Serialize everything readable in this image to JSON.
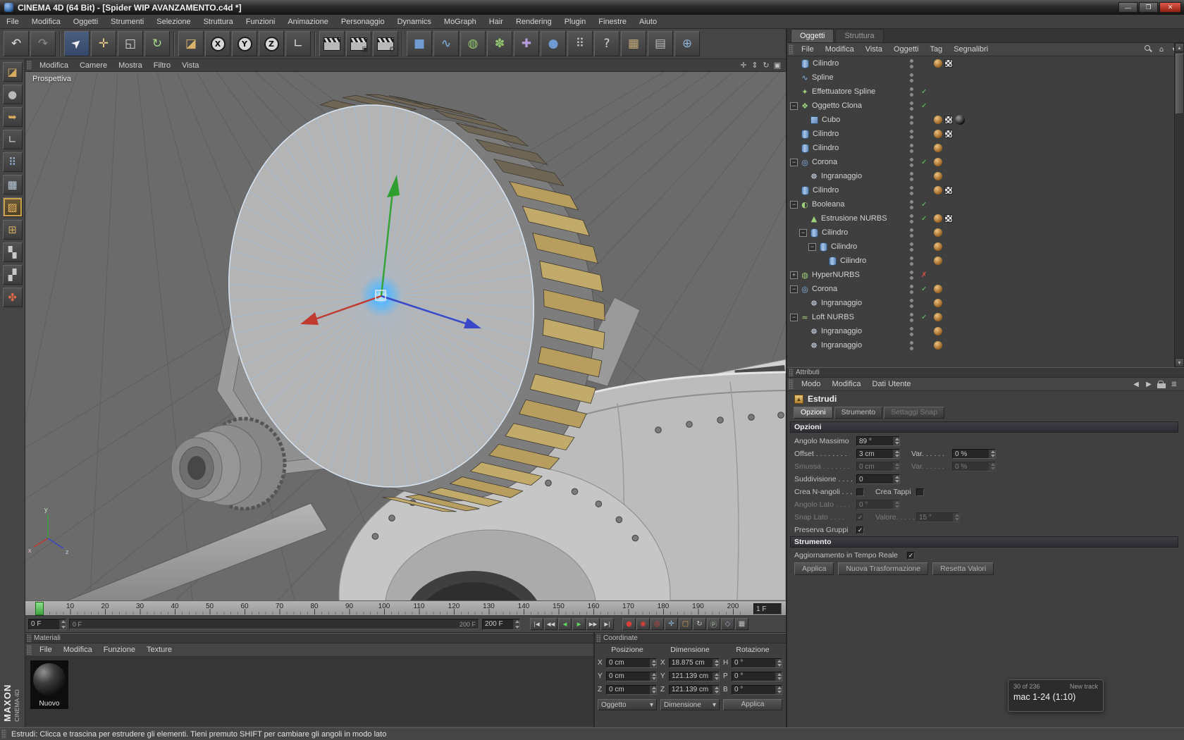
{
  "window": {
    "title": "CINEMA 4D (64 Bit) - [Spider WIP AVANZAMENTO.c4d *]",
    "controls": {
      "minimize": "—",
      "restore": "❐",
      "close": "✕"
    }
  },
  "menubar": [
    "File",
    "Modifica",
    "Oggetti",
    "Strumenti",
    "Selezione",
    "Struttura",
    "Funzioni",
    "Animazione",
    "Personaggio",
    "Dynamics",
    "MoGraph",
    "Hair",
    "Rendering",
    "Plugin",
    "Finestre",
    "Aiuto"
  ],
  "toolbar": [
    {
      "name": "undo-button",
      "glyph": "↶",
      "fg": "#e0e0e0"
    },
    {
      "name": "redo-button",
      "glyph": "↷",
      "fg": "#8a8a8a"
    },
    {
      "sep": true
    },
    {
      "name": "live-selection-tool",
      "glyph": "➤",
      "fg": "#f0f0f0",
      "rot": -40,
      "bg": true
    },
    {
      "name": "move-tool",
      "glyph": "✛",
      "fg": "#e6c98a"
    },
    {
      "name": "scale-tool",
      "glyph": "◱",
      "fg": "#dcdcdc"
    },
    {
      "name": "rotate-tool",
      "glyph": "↻",
      "fg": "#a6d88a"
    },
    {
      "sep": true
    },
    {
      "name": "last-used-tool",
      "glyph": "◪",
      "fg": "#d8b26a"
    },
    {
      "name": "lock-x-axis-button",
      "axis": "X"
    },
    {
      "name": "lock-y-axis-button",
      "axis": "Y"
    },
    {
      "name": "lock-z-axis-button",
      "axis": "Z"
    },
    {
      "name": "coordinate-system-toggle",
      "glyph": "∟",
      "fg": "#d8d8d8"
    },
    {
      "sep": true
    },
    {
      "name": "render-view-button",
      "clapper": true
    },
    {
      "name": "render-region-button",
      "clapper": true,
      "ovr": "▣"
    },
    {
      "name": "render-settings-button",
      "clapper": true,
      "ovr": "⚙"
    },
    {
      "sep": true
    },
    {
      "name": "add-primitive-button",
      "glyph": "■",
      "fg": "#6f9bd2"
    },
    {
      "name": "add-spline-button",
      "glyph": "∿",
      "fg": "#86b8e8"
    },
    {
      "name": "add-nurbs-button",
      "glyph": "◍",
      "fg": "#92c66e"
    },
    {
      "name": "add-mograph-button",
      "glyph": "✽",
      "fg": "#92c66e"
    },
    {
      "name": "add-deformer-button",
      "glyph": "✚",
      "fg": "#b49ad8"
    },
    {
      "name": "add-scene-object-button",
      "glyph": "●",
      "fg": "#6f9bd2"
    },
    {
      "name": "add-particles-button",
      "glyph": "⠿",
      "fg": "#c0c0c0"
    },
    {
      "name": "help-button",
      "glyph": "?",
      "fg": "#d8d8d8"
    },
    {
      "name": "add-stage-button",
      "glyph": "▦",
      "fg": "#c0a878"
    },
    {
      "name": "content-browser-button",
      "glyph": "▤",
      "fg": "#b8b8b8"
    },
    {
      "name": "online-help-button",
      "glyph": "⊕",
      "fg": "#8fb2d8"
    }
  ],
  "left_palette": [
    {
      "name": "make-editable-button",
      "glyph": "◪",
      "fg": "#d8aa5e"
    },
    {
      "name": "model-mode-button",
      "glyph": "●",
      "fg": "#b8b8b8"
    },
    {
      "name": "object-axis-mode-button",
      "glyph": "➥",
      "fg": "#d8aa5e"
    },
    {
      "name": "workplane-mode-button",
      "glyph": "∟",
      "fg": "#c8c8c8"
    },
    {
      "name": "points-mode-button",
      "glyph": "⠿",
      "fg": "#9fc0e8"
    },
    {
      "name": "edges-mode-button",
      "glyph": "▦",
      "fg": "#b8c8d8"
    },
    {
      "name": "polygons-mode-button",
      "glyph": "▨",
      "fg": "#f0b860",
      "active": true
    },
    {
      "name": "texture-mode-button",
      "glyph": "⊞",
      "fg": "#d0a860"
    },
    {
      "name": "texture-axis-mode-button",
      "glyph": "▚",
      "fg": "#c8c8c8"
    },
    {
      "name": "uv-mode-button",
      "glyph": "▞",
      "fg": "#c8c8c8"
    },
    {
      "name": "snap-settings-button",
      "glyph": "✤",
      "fg": "#d86848"
    }
  ],
  "viewport": {
    "menu": [
      "Modifica",
      "Camere",
      "Mostra",
      "Filtro",
      "Vista"
    ],
    "nav_icons": [
      {
        "name": "pan-view-icon",
        "glyph": "✛"
      },
      {
        "name": "zoom-view-icon",
        "glyph": "⇕"
      },
      {
        "name": "rotate-view-icon",
        "glyph": "↻"
      },
      {
        "name": "toggle-layout-icon",
        "glyph": "▣"
      }
    ],
    "camera_label": "Prospettiva",
    "axis_labels": {
      "x": "x",
      "y": "y",
      "z": "z"
    }
  },
  "timeline": {
    "tick_labels": [
      "10",
      "20",
      "30",
      "40",
      "50",
      "60",
      "70",
      "80",
      "90",
      "100",
      "110",
      "120",
      "130",
      "140",
      "150",
      "160",
      "170",
      "180",
      "190",
      "200"
    ],
    "frame_step": "1 F",
    "current_frame": "0 F",
    "range_start_label": "0 F",
    "range_end_label": "200 F",
    "end_frame": "200 F",
    "transport": [
      {
        "name": "goto-start-button",
        "glyph": "|◀"
      },
      {
        "name": "previous-key-button",
        "glyph": "◀◀"
      },
      {
        "name": "play-backward-button",
        "glyph": "◀",
        "green": true
      },
      {
        "name": "play-forward-button",
        "glyph": "▶",
        "green": true
      },
      {
        "name": "next-key-button",
        "glyph": "▶▶"
      },
      {
        "name": "goto-end-button",
        "glyph": "▶|"
      }
    ],
    "record_buttons": [
      {
        "name": "record-keyframe-button",
        "glyph": "●",
        "fg": "#d84038"
      },
      {
        "name": "autokeying-button",
        "glyph": "◉",
        "fg": "#d84038"
      },
      {
        "name": "record-selection-button",
        "glyph": "◎",
        "fg": "#d84038"
      },
      {
        "name": "record-position-toggle",
        "glyph": "✛",
        "fg": "#8fb2d8"
      },
      {
        "name": "record-scale-toggle",
        "glyph": "▢",
        "fg": "#d8a050"
      },
      {
        "name": "record-rotation-toggle",
        "glyph": "↻",
        "fg": "#c6c6c6"
      },
      {
        "name": "record-parameter-toggle",
        "glyph": "Ⓟ",
        "fg": "#a8c0a8"
      },
      {
        "name": "record-pla-toggle",
        "glyph": "◇",
        "fg": "#a8a8c8"
      },
      {
        "name": "timeline-layout-button",
        "glyph": "▦",
        "fg": "#bcbcbc"
      }
    ]
  },
  "materials_panel": {
    "title": "Materiali",
    "menu": [
      "File",
      "Modifica",
      "Funzione",
      "Texture"
    ],
    "materials": [
      {
        "name": "Nuovo"
      }
    ]
  },
  "coordinates_panel": {
    "title": "Coordinate",
    "groups": [
      {
        "header": "Posizione",
        "axes": [
          "X",
          "Y",
          "Z"
        ],
        "values": [
          "0 cm",
          "0 cm",
          "0 cm"
        ],
        "footer_type": "dropdown",
        "footer_label": "Oggetto",
        "footer_name": "position-mode-dropdown"
      },
      {
        "header": "Dimensione",
        "axes": [
          "X",
          "Y",
          "Z"
        ],
        "values": [
          "18.875 cm",
          "121.139 cm",
          "121.139 cm"
        ],
        "footer_type": "dropdown",
        "footer_label": "Dimensione",
        "footer_name": "dimension-mode-dropdown"
      },
      {
        "header": "Rotazione",
        "axes": [
          "H",
          "P",
          "B"
        ],
        "values": [
          "0 °",
          "0 °",
          "0 °"
        ],
        "footer_type": "button",
        "footer_label": "Applica",
        "footer_name": "apply-coordinates-button"
      }
    ]
  },
  "object_manager": {
    "tabs": [
      {
        "label": "Oggetti",
        "active": true
      },
      {
        "label": "Struttura",
        "active": false
      }
    ],
    "menu": [
      "File",
      "Modifica",
      "Vista",
      "Oggetti",
      "Tag",
      "Segnalibri"
    ],
    "header_icons": [
      {
        "name": "search-icon",
        "css": "magico"
      },
      {
        "name": "home-icon",
        "glyph": "⌂"
      },
      {
        "name": "collapse-panel-icon",
        "glyph": "▾"
      }
    ],
    "objects": [
      {
        "name": "Cilindro",
        "level": 0,
        "icon": "cylinder",
        "tags": [
          "phong",
          "texture"
        ]
      },
      {
        "name": "Spline",
        "level": 0,
        "icon": "spline",
        "tags": []
      },
      {
        "name": "Effettuatore Spline",
        "level": 0,
        "icon": "effector",
        "state": "on",
        "tags": []
      },
      {
        "name": "Oggetto Clona",
        "level": 0,
        "icon": "clone",
        "expand": "minus",
        "state": "on",
        "tags": []
      },
      {
        "name": "Cubo",
        "level": 1,
        "icon": "cube",
        "tags": [
          "phong",
          "texture",
          "material"
        ]
      },
      {
        "name": "Cilindro",
        "level": 0,
        "icon": "cylinder",
        "tags": [
          "phong",
          "texture"
        ]
      },
      {
        "name": "Cilindro",
        "level": 0,
        "icon": "cylinder",
        "tags": [
          "phong"
        ]
      },
      {
        "name": "Corona",
        "level": 0,
        "icon": "torus",
        "expand": "minus",
        "state": "on",
        "tags": [
          "phong"
        ]
      },
      {
        "name": "Ingranaggio",
        "level": 1,
        "icon": "gear",
        "tags": [
          "phong"
        ]
      },
      {
        "name": "Cilindro",
        "level": 0,
        "icon": "cylinder",
        "tags": [
          "phong",
          "texture"
        ]
      },
      {
        "name": "Booleana",
        "level": 0,
        "icon": "boole",
        "expand": "minus",
        "state": "on",
        "tags": []
      },
      {
        "name": "Estrusione NURBS",
        "level": 1,
        "icon": "extrude",
        "state": "on",
        "tags": [
          "phong",
          "texture"
        ]
      },
      {
        "name": "Cilindro",
        "level": 1,
        "icon": "cylinder",
        "expand": "minus",
        "tags": [
          "phong"
        ]
      },
      {
        "name": "Cilindro",
        "level": 2,
        "icon": "cylinder",
        "expand": "minus",
        "tags": [
          "phong"
        ]
      },
      {
        "name": "Cilindro",
        "level": 3,
        "icon": "cylinder",
        "tags": [
          "phong"
        ]
      },
      {
        "name": "HyperNURBS",
        "level": 0,
        "icon": "hypernurbs",
        "expand": "plus",
        "state": "off",
        "tags": []
      },
      {
        "name": "Corona",
        "level": 0,
        "icon": "torus",
        "expand": "minus",
        "state": "on",
        "tags": [
          "phong"
        ]
      },
      {
        "name": "Ingranaggio",
        "level": 1,
        "icon": "gear",
        "tags": [
          "phong"
        ]
      },
      {
        "name": "Loft NURBS",
        "level": 0,
        "icon": "loft",
        "expand": "minus",
        "state": "on",
        "tags": [
          "phong"
        ]
      },
      {
        "name": "Ingranaggio",
        "level": 1,
        "icon": "gear",
        "tags": [
          "phong"
        ]
      },
      {
        "name": "Ingranaggio",
        "level": 1,
        "icon": "gear",
        "tags": [
          "phong"
        ]
      }
    ]
  },
  "attribute_manager": {
    "panel_title": "Attributi",
    "menu": [
      "Modo",
      "Modifica",
      "Dati Utente"
    ],
    "icons": [
      {
        "name": "previous-object-icon",
        "glyph": "◀"
      },
      {
        "name": "next-object-icon",
        "glyph": "▶"
      },
      {
        "name": "lock-icon",
        "css": "lockico"
      },
      {
        "name": "panel-menu-icon",
        "glyph": "≣"
      }
    ],
    "object_title": "Estrudi",
    "tabs": [
      {
        "label": "Opzioni",
        "state": "active"
      },
      {
        "label": "Strumento",
        "state": "normal"
      },
      {
        "label": "Settaggi Snap",
        "state": "disabled"
      }
    ],
    "options_section": {
      "title": "Opzioni",
      "rows": [
        {
          "cells": [
            {
              "label": "Angolo Massimo",
              "type": "field",
              "value": "89 °"
            }
          ]
        },
        {
          "cells": [
            {
              "label": "Offset . . . . . . . .",
              "type": "field",
              "value": "3 cm"
            },
            {
              "label": "Var. . . . . .",
              "type": "field",
              "value": "0 %"
            }
          ]
        },
        {
          "cells": [
            {
              "label": "Smussa . . . . . . .",
              "type": "field",
              "value": "0 cm",
              "disabled": true
            },
            {
              "label": "Var. . . . . .",
              "type": "field",
              "value": "0 %",
              "disabled": true
            }
          ]
        },
        {
          "cells": [
            {
              "label": "Suddivisione . . . .",
              "type": "field",
              "value": "0"
            }
          ]
        },
        {
          "cells": [
            {
              "label": "Crea N-angoli . . .",
              "type": "checkbox",
              "checked": false
            },
            {
              "label": "Crea Tappi",
              "type": "checkbox",
              "checked": false
            }
          ]
        },
        {
          "cells": [
            {
              "label": "Angolo Lato . . . .",
              "type": "field",
              "value": "0 °",
              "disabled": true
            }
          ]
        },
        {
          "cells": [
            {
              "label": "Snap Lato . . . .",
              "type": "checkbox",
              "checked": true,
              "disabled": true
            },
            {
              "label": "Valore. . . . .",
              "type": "field",
              "value": "15 °",
              "disabled": true
            }
          ]
        },
        {
          "cells": [
            {
              "label": "Preserva Gruppi",
              "type": "checkbox",
              "checked": true
            }
          ]
        }
      ]
    },
    "tool_section": {
      "title": "Strumento",
      "rows": [
        {
          "cells": [
            {
              "label": "Aggiornamento in Tempo Reale",
              "type": "checkbox",
              "checked": true,
              "wideLabel": true
            }
          ]
        }
      ],
      "buttons": [
        {
          "label": "Applica",
          "name": "apply-tool-button"
        },
        {
          "label": "Nuova Trasformazione",
          "name": "new-transform-button"
        },
        {
          "label": "Resetta Valori",
          "name": "reset-values-button"
        }
      ]
    }
  },
  "status_bar": {
    "text": "Estrudi: Clicca e trascina per estrudere gli elementi. Tieni premuto SHIFT per cambiare gli angoli in modo lato"
  },
  "tooltip": {
    "counter": "30 of 236",
    "hint": "New track",
    "label": "mac 1-24 (1:10)"
  },
  "branding": {
    "line1": "MAXON",
    "line2": "CINEMA 4D"
  }
}
